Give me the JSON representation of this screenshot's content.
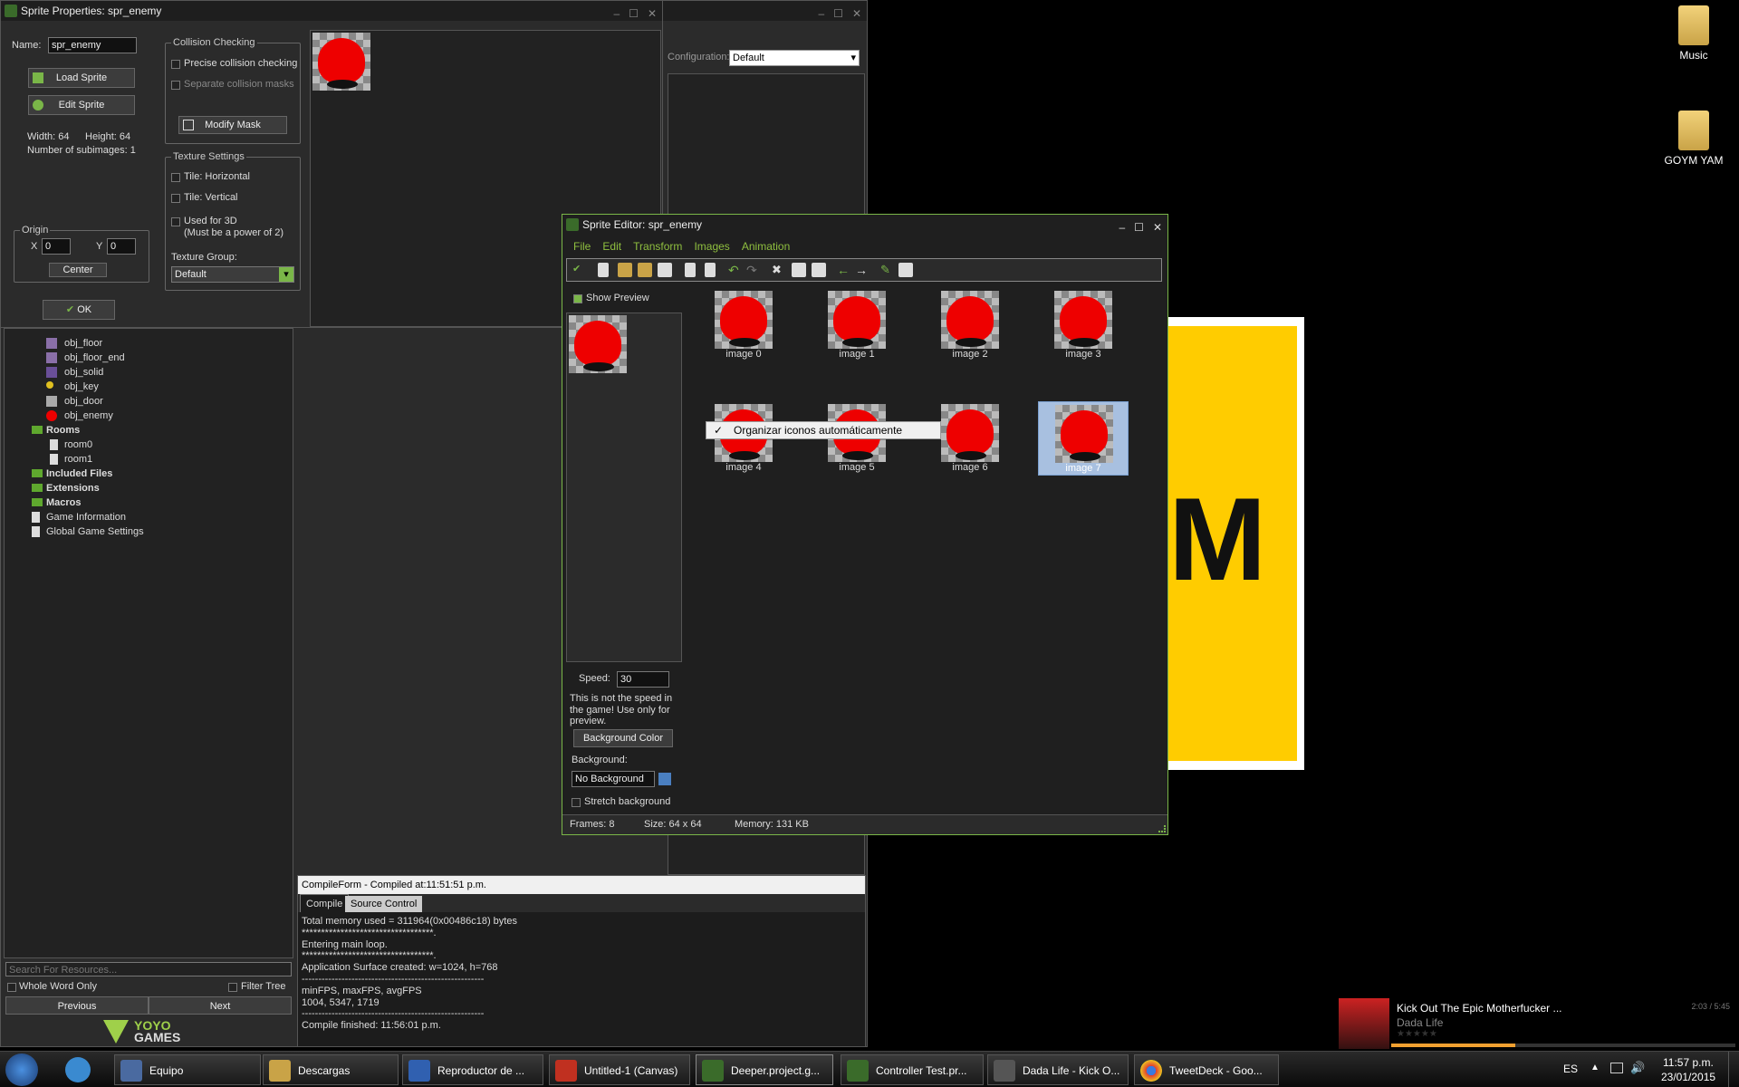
{
  "colors": {
    "accent": "#7ab648",
    "yellow": "#ffcc00",
    "selection": "#a8c0e0"
  },
  "desktop": {
    "icons": [
      {
        "label": "Music"
      },
      {
        "label": "GOYM YAM"
      }
    ],
    "yellow_panel_text": "M"
  },
  "sprite_props": {
    "title": "Sprite Properties: spr_enemy",
    "name_label": "Name:",
    "name_value": "spr_enemy",
    "load_sprite": "Load Sprite",
    "edit_sprite": "Edit Sprite",
    "width_label": "Width: 64",
    "height_label": "Height: 64",
    "subimages_label": "Number of subimages: 1",
    "origin_title": "Origin",
    "origin_x_label": "X",
    "origin_x_value": "0",
    "origin_y_label": "Y",
    "origin_y_value": "0",
    "center_button": "Center",
    "ok_button": "OK",
    "collision_title": "Collision Checking",
    "precise_collision": "Precise collision checking",
    "separate_masks": "Separate collision masks",
    "modify_mask": "Modify Mask",
    "texture_title": "Texture Settings",
    "tile_h": "Tile: Horizontal",
    "tile_v": "Tile: Vertical",
    "used_3d": "Used for 3D",
    "used_3d_note": "(Must be a power of 2)",
    "texture_group_label": "Texture Group:",
    "texture_group_value": "Default"
  },
  "main_ide": {
    "configuration_label": "Configuration:",
    "configuration_value": "Default"
  },
  "tree": {
    "items": [
      {
        "label": "obj_floor",
        "bold": false
      },
      {
        "label": "obj_floor_end",
        "bold": false
      },
      {
        "label": "obj_solid",
        "bold": false
      },
      {
        "label": "obj_key",
        "bold": false
      },
      {
        "label": "obj_door",
        "bold": false
      },
      {
        "label": "obj_enemy",
        "bold": false
      },
      {
        "label": "Rooms",
        "bold": true
      },
      {
        "label": "room0",
        "bold": false
      },
      {
        "label": "room1",
        "bold": false
      },
      {
        "label": "Included Files",
        "bold": true
      },
      {
        "label": "Extensions",
        "bold": true
      },
      {
        "label": "Macros",
        "bold": true
      },
      {
        "label": "Game Information",
        "bold": false
      },
      {
        "label": "Global Game Settings",
        "bold": false
      }
    ],
    "search_placeholder": "Search For Resources...",
    "whole_word": "Whole Word Only",
    "filter_tree": "Filter Tree",
    "previous": "Previous",
    "next": "Next",
    "logo_top": "YOYO",
    "logo_bottom": "GAMES"
  },
  "compile": {
    "header": "CompileForm - Compiled at:11:51:51 p.m.",
    "tabs": [
      "Compile",
      "Source Control"
    ],
    "lines": [
      "Total memory used = 311964(0x00486c18) bytes",
      "**********************************.",
      "Entering main loop.",
      "**********************************.",
      "Application Surface created: w=1024, h=768",
      "-------------------------------------------------------",
      "minFPS, maxFPS, avgFPS",
      "1004, 5347, 1719",
      "-------------------------------------------------------",
      "Compile finished: 11:56:01 p.m."
    ]
  },
  "sprite_editor": {
    "title": "Sprite Editor: spr_enemy",
    "menu": [
      "File",
      "Edit",
      "Transform",
      "Images",
      "Animation"
    ],
    "show_preview": "Show Preview",
    "images": [
      "image 0",
      "image 1",
      "image 2",
      "image 3",
      "image 4",
      "image 5",
      "image 6",
      "image 7"
    ],
    "selected_index": 7,
    "context_menu_item": "Organizar iconos automáticamente",
    "speed_label": "Speed:",
    "speed_value": "30",
    "speed_note": "This is not the speed in the game! Use only for preview.",
    "background_color_btn": "Background Color",
    "background_label": "Background:",
    "background_value": "No Background",
    "stretch_background": "Stretch background",
    "status_frames": "Frames: 8",
    "status_size": "Size: 64 x 64",
    "status_memory": "Memory: 131 KB"
  },
  "media": {
    "track": "Kick Out The Epic Motherfucker ...",
    "artist": "Dada Life",
    "time": "2:03 / 5:45",
    "progress": 0.36
  },
  "taskbar": {
    "items": [
      {
        "label": "Equipo"
      },
      {
        "label": "Descargas"
      },
      {
        "label": "Reproductor de ..."
      },
      {
        "label": "Untitled-1 (Canvas)"
      },
      {
        "label": "Deeper.project.g..."
      },
      {
        "label": "Controller Test.pr..."
      },
      {
        "label": "Dada Life - Kick O..."
      },
      {
        "label": "TweetDeck - Goo..."
      }
    ],
    "lang": "ES",
    "time": "11:57 p.m.",
    "date": "23/01/2015"
  }
}
